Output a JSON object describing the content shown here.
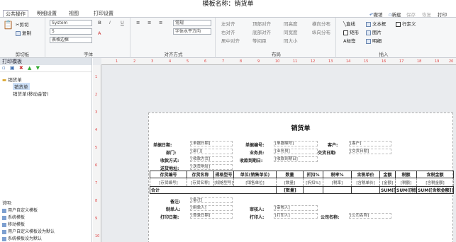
{
  "window": {
    "title": "模板名称：销货单"
  },
  "tabs": [
    {
      "label": "公共操作",
      "active": true
    },
    {
      "label": "明细设置"
    },
    {
      "label": "视图"
    },
    {
      "label": "打印设置"
    }
  ],
  "quick_actions": [
    "撤销",
    "新建",
    "保存",
    "恢复",
    "打印"
  ],
  "ribbon": {
    "clipboard": {
      "cut": "剪切",
      "copy": "复制",
      "label": "剪切板"
    },
    "font": {
      "family": "System",
      "size": "5",
      "style": "表格边框",
      "label": "字体",
      "bold": "B",
      "italic": "I",
      "underline": "U"
    },
    "align": {
      "label": "对齐方式",
      "select1": "常规",
      "select2": "字体水平方向"
    },
    "layout": {
      "label": "布局",
      "items": [
        "左对齐",
        "右对齐",
        "同高度",
        "居中对齐",
        "同宽度",
        "顶部对齐",
        "底部对齐",
        "同大小",
        "等间距",
        "横向分布",
        "纵向分布",
        "前置",
        "后置"
      ]
    },
    "insert": {
      "label": "插入",
      "items": [
        "直线",
        "文本框",
        "矩形",
        "图片",
        "标签",
        "明细",
        "行定义"
      ]
    }
  },
  "left_panel": {
    "title": "打印模板",
    "tree_root": "销货单",
    "tree_items": [
      "销货单",
      "销货单(移动金管)"
    ],
    "help_title": "说明:",
    "help_items": [
      "用户自定义模板",
      "系统模板",
      "移动模板",
      "用户自定义模板设为默认",
      "系统模板设为默认"
    ]
  },
  "ruler": {
    "h": [
      "1",
      "2",
      "3",
      "4",
      "5",
      "6",
      "7",
      "8",
      "9",
      "10",
      "11",
      "12",
      "13",
      "14",
      "15",
      "16",
      "17",
      "18",
      "19",
      "20"
    ],
    "v": [
      "1",
      "2",
      "3",
      "4",
      "5",
      "6",
      "7",
      "8",
      "9",
      "10"
    ]
  },
  "document": {
    "title": "销货单",
    "fields": [
      {
        "label": "单据日期:",
        "value": "[单据日期]"
      },
      {
        "label": "单据编号:",
        "value": "[单据编号]"
      },
      {
        "label": "客户:",
        "value": "[客户]"
      },
      {
        "label": "部门:",
        "value": "[部门]"
      },
      {
        "label": "业务员:",
        "value": "[业务员]"
      },
      {
        "label": "交货日期:",
        "value": "[交货日期]"
      },
      {
        "label": "收款方式:",
        "value": "[收款方式]"
      },
      {
        "label": "收款到期日:",
        "value": "[收款到期日]"
      },
      {
        "label": "送货地址:",
        "value": "[送货地址]"
      }
    ],
    "table_headers": [
      "存货编号",
      "存货名称",
      "规格型号",
      "单位(销售单位)",
      "数量",
      "折扣%",
      "税率%",
      "含税单价",
      "金额",
      "税额",
      "含税金额"
    ],
    "table_row": [
      "[存货编号]",
      "[存货名称]",
      "[规格型号]",
      "[销售单位]",
      "[数量]",
      "[折扣%]",
      "[税率]",
      "[含税单价]",
      "[金额]",
      "[税额]",
      "[含税金额]"
    ],
    "total_label": "合计",
    "total_values": [
      "[数量]",
      "SUM([金额])",
      "SUM([税额])",
      "SUM([含税金额])"
    ],
    "footer": [
      {
        "label": "备注:",
        "value": "[备注]"
      },
      {
        "label": "制单人:",
        "value": "[制单人]"
      },
      {
        "label": "审核人:",
        "value": "[审核人]"
      },
      {
        "label": "打印日期:",
        "value": "[登录日期]"
      },
      {
        "label": "打印人:",
        "value": "[打印人]"
      },
      {
        "label": "公司名称:",
        "value": "[公司名称]"
      }
    ]
  }
}
